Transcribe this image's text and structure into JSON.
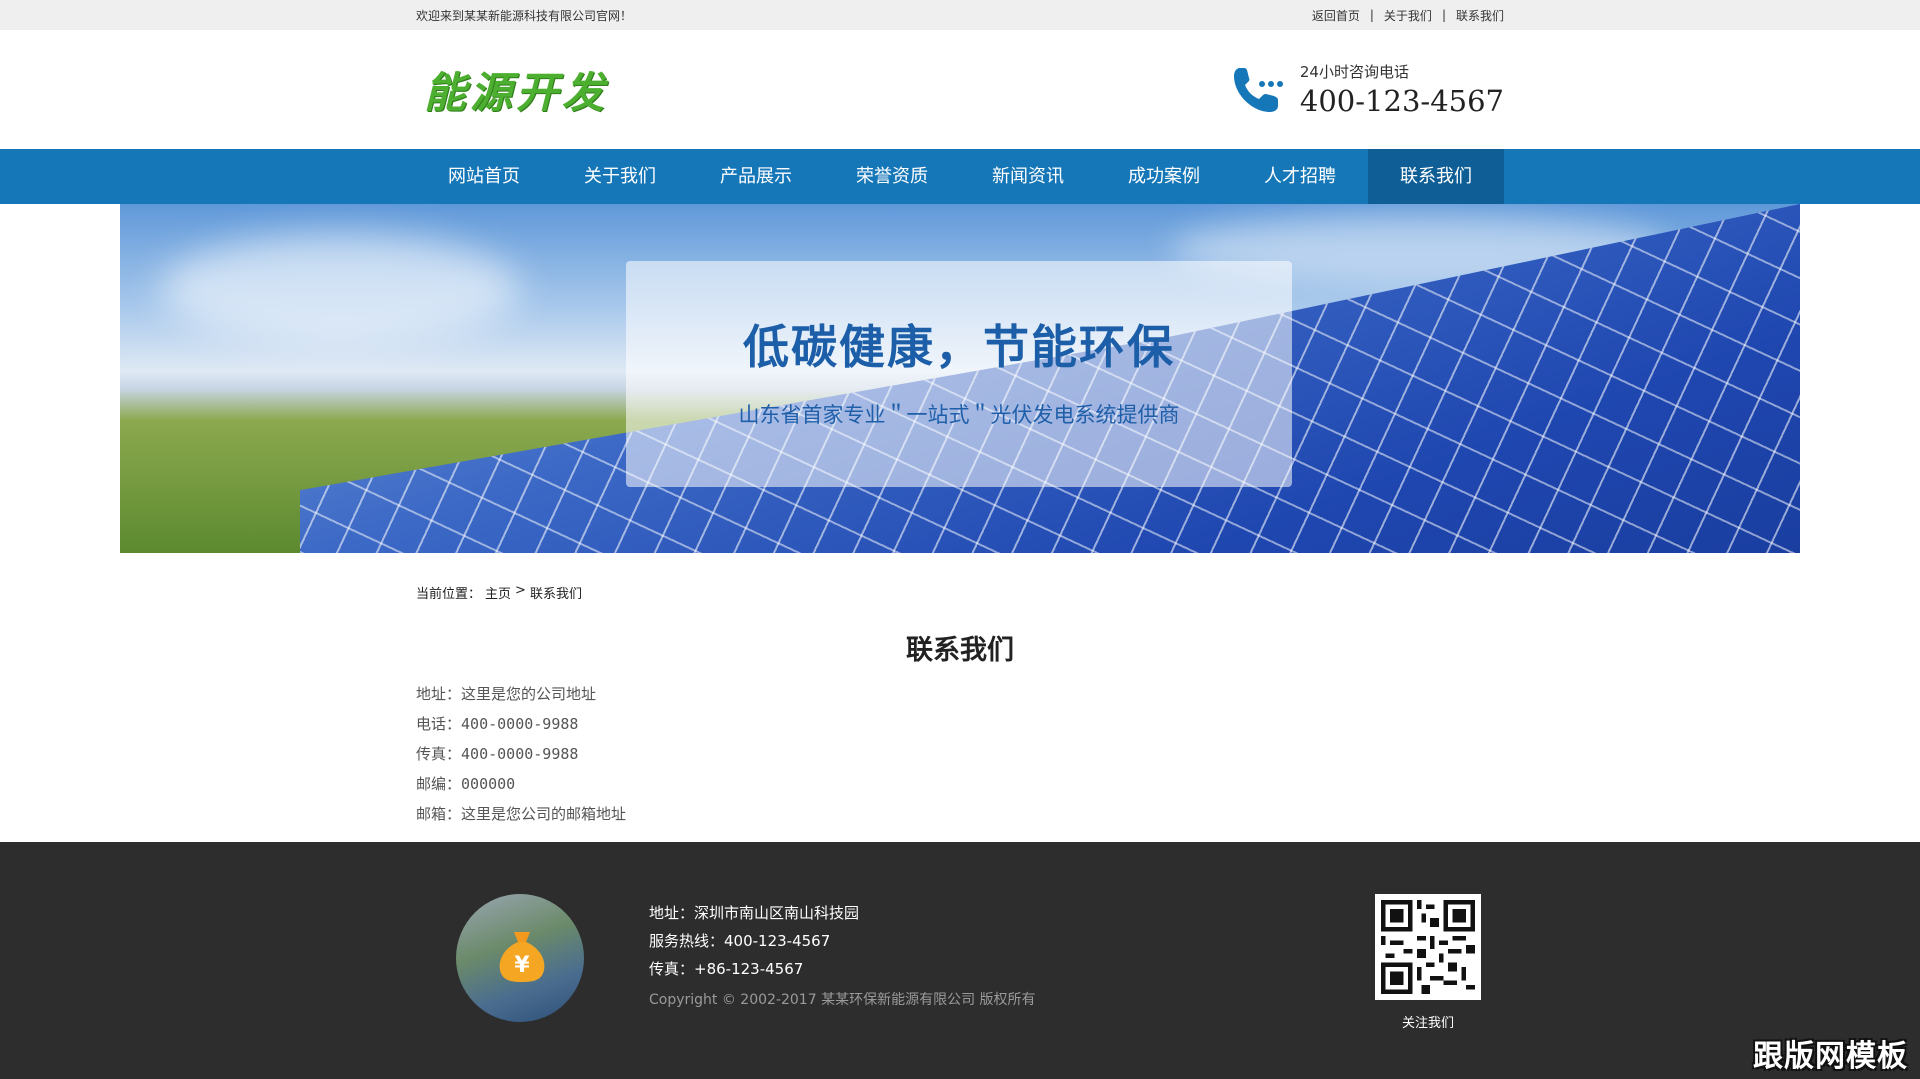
{
  "topbar": {
    "welcome": "欢迎来到某某新能源科技有限公司官网！",
    "links": [
      "返回首页",
      "关于我们",
      "联系我们"
    ],
    "separator": "|"
  },
  "header": {
    "logo_text": "能源开发",
    "hotline_label": "24小时咨询电话",
    "hotline_number": "400-123-4567",
    "icon": "phone-icon",
    "accent_color": "#1677b8"
  },
  "nav": {
    "items": [
      "网站首页",
      "关于我们",
      "产品展示",
      "荣誉资质",
      "新闻资讯",
      "成功案例",
      "人才招聘",
      "联系我们"
    ],
    "active_index": 7
  },
  "banner": {
    "slogan": "低碳健康，节能环保",
    "subslogan": "山东省首家专业＂一站式＂光伏发电系统提供商"
  },
  "breadcrumb": {
    "prefix": "当前位置：",
    "home": "主页",
    "arrow": ">",
    "current": "联系我们"
  },
  "content": {
    "title": "联系我们",
    "rows": [
      {
        "key": "地址：",
        "value": "这里是您的公司地址"
      },
      {
        "key": "电话：",
        "value": "400-0000-9988"
      },
      {
        "key": "传真：",
        "value": "400-0000-9988"
      },
      {
        "key": "邮编：",
        "value": "000000"
      },
      {
        "key": "邮箱：",
        "value": "这里是您公司的邮箱地址"
      }
    ]
  },
  "footer": {
    "address": "地址：深圳市南山区南山科技园",
    "hotline": "服务热线：400-123-4567",
    "fax": "传真：+86-123-4567",
    "copyright": "Copyright © 2002-2017 某某环保新能源有限公司 版权所有",
    "qr_caption": "关注我们",
    "watermark": "跟版网模板"
  }
}
